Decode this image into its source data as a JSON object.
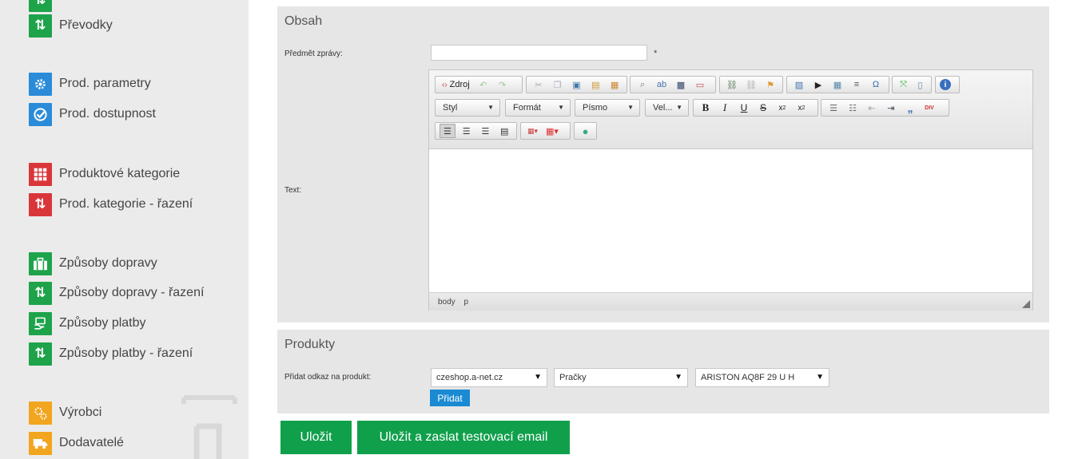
{
  "sidebar": {
    "items": [
      {
        "label": "Převodky",
        "icon": "arrows-up-down-icon",
        "color": "#1ea34a"
      },
      {
        "label": "Prod. parametry",
        "icon": "gear-icon",
        "color": "#2a8bd8"
      },
      {
        "label": "Prod. dostupnost",
        "icon": "check-icon",
        "color": "#2a8bd8"
      },
      {
        "label": "Produktové kategorie",
        "icon": "grid-icon",
        "color": "#d9363a"
      },
      {
        "label": "Prod. kategorie - řazení",
        "icon": "arrows-up-down-icon",
        "color": "#d9363a"
      },
      {
        "label": "Způsoby dopravy",
        "icon": "briefcase-icon",
        "color": "#1ea34a"
      },
      {
        "label": "Způsoby dopravy - řazení",
        "icon": "arrows-up-down-icon",
        "color": "#1ea34a"
      },
      {
        "label": "Způsoby platby",
        "icon": "money-icon",
        "color": "#1ea34a"
      },
      {
        "label": "Způsoby platby - řazení",
        "icon": "arrows-up-down-icon",
        "color": "#1ea34a"
      },
      {
        "label": "Výrobci",
        "icon": "gears-icon",
        "color": "#f2a51e"
      },
      {
        "label": "Dodavatelé",
        "icon": "truck-icon",
        "color": "#f2a51e"
      }
    ]
  },
  "obsah": {
    "title": "Obsah",
    "subject_label": "Předmět zprávy:",
    "subject_value": "",
    "required_mark": "*",
    "text_label": "Text:"
  },
  "editor": {
    "source_label": "Zdroj",
    "combos": {
      "style": "Styl",
      "format": "Formát",
      "font": "Písmo",
      "size": "Vel..."
    },
    "status_path": [
      "body",
      "p"
    ]
  },
  "produkty": {
    "title": "Produkty",
    "add_link_label": "Přidat odkaz na produkt:",
    "shop_select": "czeshop.a-net.cz",
    "category_select": "Pračky",
    "product_select": "ARISTON AQ8F 29 U H",
    "add_button": "Přidat"
  },
  "actions": {
    "save": "Uložit",
    "save_and_test": "Uložit a zaslat testovací email"
  },
  "colors": {
    "green": "#10a04c",
    "blue": "#1a8ad3",
    "panel": "#e6e6e6",
    "sidebar": "#ebebeb"
  }
}
